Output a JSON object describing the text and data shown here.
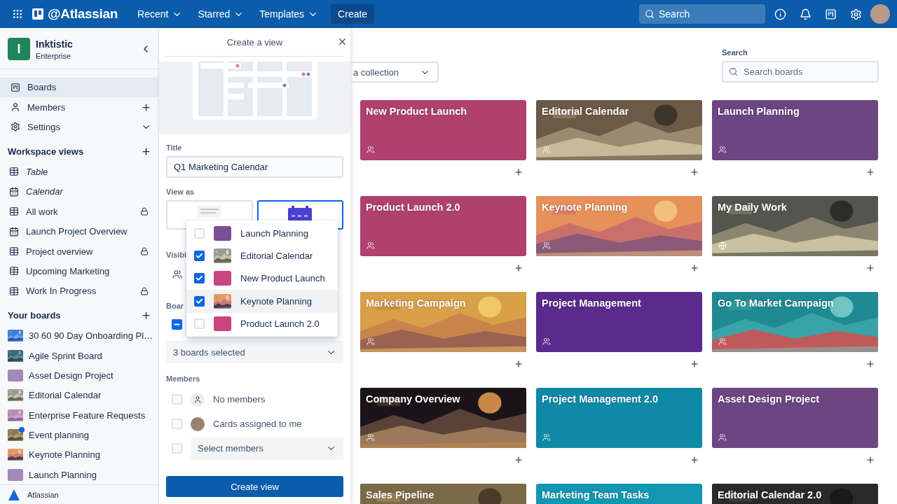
{
  "top_bar": {
    "brand": "@Atlassian",
    "menus": [
      {
        "label": "Recent"
      },
      {
        "label": "Starred"
      },
      {
        "label": "Templates"
      }
    ],
    "create": "Create",
    "search": {
      "placeholder": "Search"
    }
  },
  "sidebar": {
    "workspace": {
      "initial": "I",
      "name": "Inktistic",
      "plan": "Enterprise"
    },
    "nav": [
      {
        "label": "Boards",
        "kind": "boards",
        "selected": true,
        "addable": false,
        "expandable": false
      },
      {
        "label": "Members",
        "kind": "members",
        "selected": false,
        "addable": true,
        "expandable": false
      },
      {
        "label": "Settings",
        "kind": "settings",
        "selected": false,
        "addable": false,
        "expandable": true
      }
    ],
    "views_heading": "Workspace views",
    "views": [
      {
        "label": "Table",
        "kind": "table",
        "emphasized": true,
        "locked": false
      },
      {
        "label": "Calendar",
        "kind": "calendar",
        "emphasized": true,
        "locked": false
      },
      {
        "label": "All work",
        "kind": "table",
        "emphasized": false,
        "locked": true
      },
      {
        "label": "Launch Project Overview",
        "kind": "calendar",
        "emphasized": false,
        "locked": false
      },
      {
        "label": "Project overview",
        "kind": "table",
        "emphasized": false,
        "locked": true
      },
      {
        "label": "Upcoming Marketing",
        "kind": "table",
        "emphasized": false,
        "locked": false
      },
      {
        "label": "Work In Progress",
        "kind": "table",
        "emphasized": false,
        "locked": true
      }
    ],
    "boards_heading": "Your boards",
    "boards": [
      {
        "label": "30 60 90 Day Onboarding Pl…",
        "kind": "picture",
        "unread": false
      },
      {
        "label": "Agile Sprint Board",
        "kind": "picture",
        "unread": false
      },
      {
        "label": "Asset Design Project",
        "kind": "color",
        "color": "#a488bb",
        "unread": false
      },
      {
        "label": "Editorial Calendar",
        "kind": "picture",
        "unread": false
      },
      {
        "label": "Enterprise Feature Requests",
        "kind": "picture",
        "unread": false
      },
      {
        "label": "Event planning",
        "kind": "picture",
        "unread": true
      },
      {
        "label": "Keynote Planning",
        "kind": "picture",
        "unread": false
      },
      {
        "label": "Launch Planning",
        "kind": "color",
        "color": "#a488bb",
        "unread": false
      }
    ],
    "footer": "Atlassian"
  },
  "panel": {
    "title": "Create a view",
    "title_label": "Title",
    "title_value": "Q1 Marketing Calendar",
    "view_as_label": "View as",
    "view_options": [
      {
        "kind": "table",
        "selected": false
      },
      {
        "kind": "calendar",
        "selected": true
      }
    ],
    "visibility_label": "Visibi",
    "boards_label": "Boar",
    "boards_indeterminate": true,
    "board_menu": [
      {
        "label": "Launch Planning",
        "kind": "color",
        "color": "#7a4f93",
        "checked": false,
        "hovered": false
      },
      {
        "label": "Editorial Calendar",
        "kind": "picture",
        "checked": true,
        "hovered": false
      },
      {
        "label": "New Product Launch",
        "kind": "color",
        "color": "#c9457d",
        "checked": true,
        "hovered": false
      },
      {
        "label": "Keynote Planning",
        "kind": "picture",
        "checked": true,
        "hovered": true
      },
      {
        "label": "Product Launch 2.0",
        "kind": "color",
        "color": "#c9457d",
        "checked": false,
        "hovered": false
      }
    ],
    "boards_select": "3 boards selected",
    "members_label": "Members",
    "members": [
      {
        "label": "No members",
        "kind": "none",
        "checked": false
      },
      {
        "label": "Cards assigned to me",
        "kind": "me",
        "checked": false
      }
    ],
    "members_select": {
      "placeholder": "Select members",
      "checked": false
    },
    "submit": "Create view"
  },
  "main": {
    "collection": "a collection",
    "search_label": "Search",
    "search": {
      "placeholder": "Search boards"
    },
    "boards": [
      {
        "title": "New Product Launch",
        "kind": "color",
        "color": "#b0416f",
        "public": false
      },
      {
        "title": "Editorial Calendar",
        "kind": "picture",
        "public": false
      },
      {
        "title": "Launch Planning",
        "kind": "color",
        "color": "#6c4583",
        "public": false
      },
      {
        "title": "Product Launch 2.0",
        "kind": "color",
        "color": "#b0416f",
        "public": false
      },
      {
        "title": "Keynote Planning",
        "kind": "picture",
        "public": false
      },
      {
        "title": "My Daily Work",
        "kind": "picture",
        "public": true
      },
      {
        "title": "Marketing Campaign",
        "kind": "picture",
        "public": false
      },
      {
        "title": "Project Management",
        "kind": "color",
        "color": "#5a2b8c",
        "public": false
      },
      {
        "title": "Go To Market Campaign",
        "kind": "picture",
        "public": false
      },
      {
        "title": "Company Overview",
        "kind": "picture",
        "public": false
      },
      {
        "title": "Project Management 2.0",
        "kind": "color",
        "color": "#0f8aa6",
        "public": false
      },
      {
        "title": "Asset Design Project",
        "kind": "color",
        "color": "#6c4583",
        "public": false
      },
      {
        "title": "Sales Pipeline",
        "kind": "picture"
      },
      {
        "title": "Marketing Team Tasks",
        "kind": "color",
        "color": "#1297b3"
      },
      {
        "title": "Editorial Calendar 2.0",
        "kind": "picture"
      }
    ]
  }
}
